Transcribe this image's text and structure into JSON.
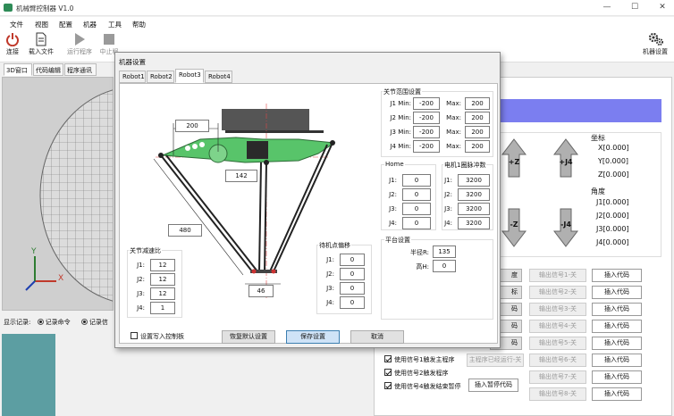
{
  "window": {
    "title": "机械臂控制器 V1.0",
    "minimize": "—",
    "maximize": "☐",
    "close": "✕"
  },
  "menu": [
    "文件",
    "视图",
    "配置",
    "机器",
    "工具",
    "帮助"
  ],
  "toolbar": {
    "connect": "连接",
    "load_file": "载入文件",
    "run_program": "运行程序",
    "stop": "中止程",
    "machine_settings": "机器设置"
  },
  "left_tabs": [
    "3D窗口",
    "代码编辑",
    "程序通讯"
  ],
  "scene": {
    "axis_x": "X",
    "axis_y": "Y"
  },
  "display_record": {
    "label": "显示记录:",
    "opt1": "记录命令",
    "opt2": "记录信"
  },
  "jog": {
    "z_up": "+Z",
    "z_down": "-Z",
    "j4_up": "+J4",
    "j4_down": "-J4"
  },
  "coords": {
    "title": "坐标",
    "x": "X[0.000]",
    "y": "Y[0.000]",
    "z": "Z[0.000]"
  },
  "angles": {
    "title": "角度",
    "j1": "J1[0.000]",
    "j2": "J2[0.000]",
    "j3": "J3[0.000]",
    "j4": "J4[0.000]"
  },
  "signals": {
    "partial_left": [
      "度",
      "标",
      "码",
      "码",
      "码"
    ],
    "outputs": [
      "输出信号1-关",
      "输出信号2-关",
      "输出信号3-关",
      "输出信号4-关",
      "输出信号5-关",
      "输出信号6-关",
      "输出信号7-关",
      "输出信号8-关"
    ],
    "insert_code": "插入代码"
  },
  "options": {
    "opt1": "使用信号1触发主程序",
    "opt2": "使用信号2触发程序",
    "opt3": "使用信号4触发结束暂停",
    "main_running": "主程序已经运行-关",
    "insert_pause": "插入暂停代码"
  },
  "dialog": {
    "title": "机器设置",
    "tabs": [
      "Robot1",
      "Robot2",
      "Robot3",
      "Robot4"
    ],
    "dims": {
      "top": "200",
      "center": "142",
      "arm": "480",
      "bottom": "46"
    },
    "joint_range": {
      "title": "关节范围设置",
      "rows": [
        {
          "label": "J1 Min:",
          "min": "-200",
          "maxlabel": "Max:",
          "max": "200"
        },
        {
          "label": "J2 Min:",
          "min": "-200",
          "maxlabel": "Max:",
          "max": "200"
        },
        {
          "label": "J3 Min:",
          "min": "-200",
          "maxlabel": "Max:",
          "max": "200"
        },
        {
          "label": "J4 Min:",
          "min": "-200",
          "maxlabel": "Max:",
          "max": "200"
        }
      ]
    },
    "home": {
      "title": "Home",
      "rows": [
        {
          "label": "J1:",
          "value": "0"
        },
        {
          "label": "J2:",
          "value": "0"
        },
        {
          "label": "J3:",
          "value": "0"
        },
        {
          "label": "J4:",
          "value": "0"
        }
      ]
    },
    "pulses": {
      "title": "电机1圈脉冲数",
      "rows": [
        {
          "label": "J1:",
          "value": "3200"
        },
        {
          "label": "J2:",
          "value": "3200"
        },
        {
          "label": "J3:",
          "value": "3200"
        },
        {
          "label": "J4:",
          "value": "3200"
        }
      ]
    },
    "platform": {
      "title": "平台设置",
      "radius_label": "半径R:",
      "radius": "135",
      "height_label": "高H:",
      "height": "0"
    },
    "reduction": {
      "title": "关节减速比",
      "rows": [
        {
          "label": "J1:",
          "value": "12"
        },
        {
          "label": "J2:",
          "value": "12"
        },
        {
          "label": "J3:",
          "value": "12"
        },
        {
          "label": "J4:",
          "value": "1"
        }
      ]
    },
    "standby": {
      "title": "待机点偏移",
      "rows": [
        {
          "label": "J1:",
          "value": "0"
        },
        {
          "label": "J2:",
          "value": "0"
        },
        {
          "label": "J3:",
          "value": "0"
        },
        {
          "label": "J4:",
          "value": "0"
        }
      ]
    },
    "write_controller": "设置写入控制板",
    "restore": "恢复默认设置",
    "save": "保存设置",
    "cancel": "取消"
  }
}
